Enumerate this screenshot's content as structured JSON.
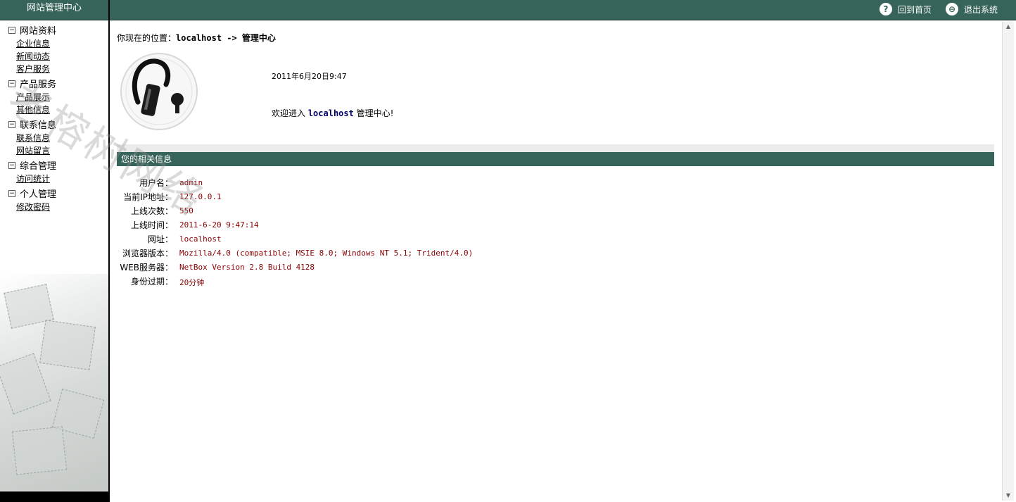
{
  "header": {
    "site_title": "网站管理中心",
    "home_link": "回到首页",
    "logout_link": "退出系统"
  },
  "sidebar": {
    "groups": [
      {
        "label": "网站资料",
        "items": [
          "企业信息",
          "新闻动态",
          "客户服务"
        ]
      },
      {
        "label": "产品服务",
        "items": [
          "产品展示",
          "其他信息"
        ]
      },
      {
        "label": "联系信息",
        "items": [
          "联系信息",
          "网站留言"
        ]
      },
      {
        "label": "综合管理",
        "items": [
          "访问统计"
        ]
      },
      {
        "label": "个人管理",
        "items": [
          "修改密码"
        ]
      }
    ],
    "collapse_symbol": "−"
  },
  "main": {
    "breadcrumb_prefix": "你现在的位置：",
    "breadcrumb_path": "localhost -> 管理中心",
    "datetime": "2011年6月20日9:47",
    "welcome_prefix": "欢迎进入 ",
    "welcome_host": "localhost",
    "welcome_suffix": " 管理中心!",
    "section_title": "您的相关信息",
    "info": [
      {
        "label": "用户名：",
        "value": "admin"
      },
      {
        "label": "当前IP地址：",
        "value": "127.0.0.1"
      },
      {
        "label": "上线次数：",
        "value": "550"
      },
      {
        "label": "上线时间：",
        "value": "2011-6-20 9:47:14"
      },
      {
        "label": "网址：",
        "value": "localhost"
      },
      {
        "label": "浏览器版本：",
        "value": "Mozilla/4.0 (compatible; MSIE 8.0; Windows NT 5.1; Trident/4.0)"
      },
      {
        "label": "WEB服务器：",
        "value": "NetBox Version 2.8 Build 4128"
      },
      {
        "label": "身份过期：",
        "value": "20分钟"
      }
    ]
  },
  "watermark": "老榕树网络",
  "colors": {
    "header_bg": "#36645a",
    "section_bg": "#36645a",
    "value_text": "#8b0000"
  }
}
